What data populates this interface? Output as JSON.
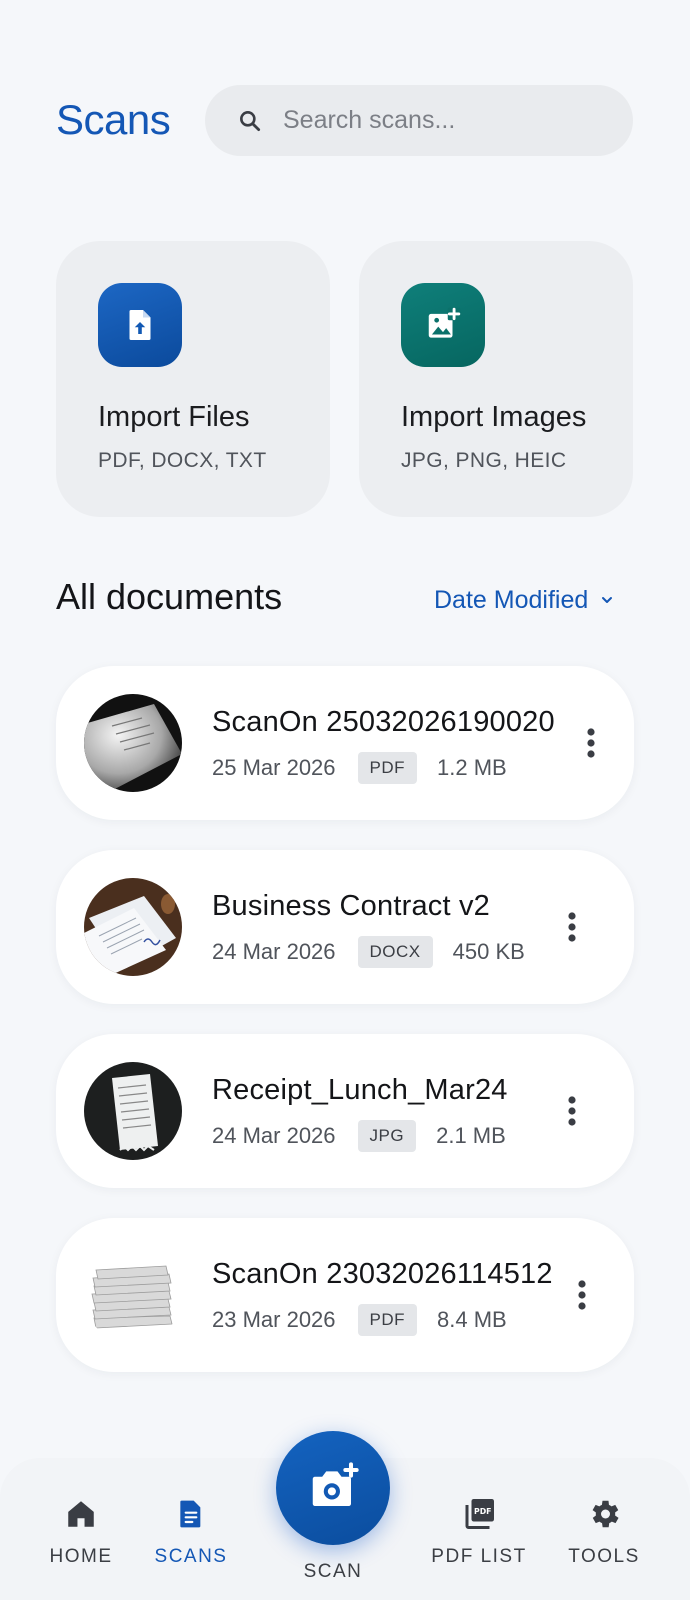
{
  "header": {
    "title": "Scans",
    "search_placeholder": "Search scans..."
  },
  "import": {
    "files": {
      "title": "Import Files",
      "subtitle": "PDF, DOCX, TXT",
      "icon": "file-upload-icon"
    },
    "images": {
      "title": "Import Images",
      "subtitle": "JPG, PNG, HEIC",
      "icon": "add-image-icon"
    }
  },
  "documents_section": {
    "title": "All documents",
    "sort_label": "Date Modified"
  },
  "documents": [
    {
      "name": "ScanOn 25032026190020",
      "date": "25 Mar 2026",
      "type": "PDF",
      "size": "1.2 MB",
      "thumbnail": "paper-document-photo"
    },
    {
      "name": "Business Contract v2",
      "date": "24 Mar 2026",
      "type": "DOCX",
      "size": "450 KB",
      "thumbnail": "contract-papers-photo"
    },
    {
      "name": "Receipt_Lunch_Mar24",
      "date": "24 Mar 2026",
      "type": "JPG",
      "size": "2.1 MB",
      "thumbnail": "receipt-photo"
    },
    {
      "name": "ScanOn 23032026114512",
      "date": "23 Mar 2026",
      "type": "PDF",
      "size": "8.4 MB",
      "thumbnail": "paper-stack-photo"
    }
  ],
  "bottom_nav": {
    "home": "HOME",
    "scans": "SCANS",
    "scan": "SCAN",
    "pdf_list": "PDF LIST",
    "tools": "TOOLS",
    "active": "scans"
  },
  "colors": {
    "accent": "#1457b5",
    "files_icon_bg": "#0b4a9c",
    "images_icon_bg": "#066660",
    "background": "#f5f7fa"
  }
}
